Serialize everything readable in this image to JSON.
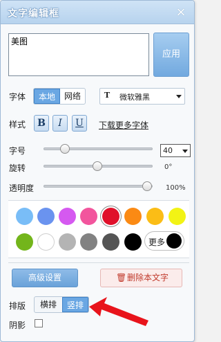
{
  "window": {
    "title": "文字编辑框",
    "close_glyph": "×"
  },
  "text_input": {
    "value": "美图"
  },
  "apply_label": "应用",
  "font": {
    "label": "字体",
    "source_options": [
      "本地",
      "网络"
    ],
    "source_selected": "本地",
    "family_icon": "T",
    "family_value": "微软雅黑"
  },
  "style": {
    "label": "样式",
    "bold_label": "B",
    "italic_label": "I",
    "underline_label": "U",
    "download_link": "下载更多字体"
  },
  "size": {
    "label": "字号",
    "value": "40"
  },
  "rotation": {
    "label": "旋转",
    "readout": "0°"
  },
  "opacity": {
    "label": "透明度",
    "readout": "100%"
  },
  "colors": {
    "row1": [
      "#79bdf7",
      "#6a93ef",
      "#d559f0",
      "#f2559d",
      "#e0102a",
      "#fb8a14",
      "#fbbd16",
      "#f2f315"
    ],
    "row2": [
      "#73b51b",
      "#ffffff",
      "#b4b4b4",
      "#828282",
      "#555555",
      "#000000"
    ],
    "selected": "#e0102a",
    "more_label": "更多",
    "more_color": "#000000"
  },
  "advanced_button": "高级设置",
  "delete_button": "删除本文字",
  "layout": {
    "label": "排版",
    "options": [
      "横排",
      "竖排"
    ],
    "selected": "竖排"
  },
  "shadow": {
    "label": "阴影",
    "checked": false
  }
}
